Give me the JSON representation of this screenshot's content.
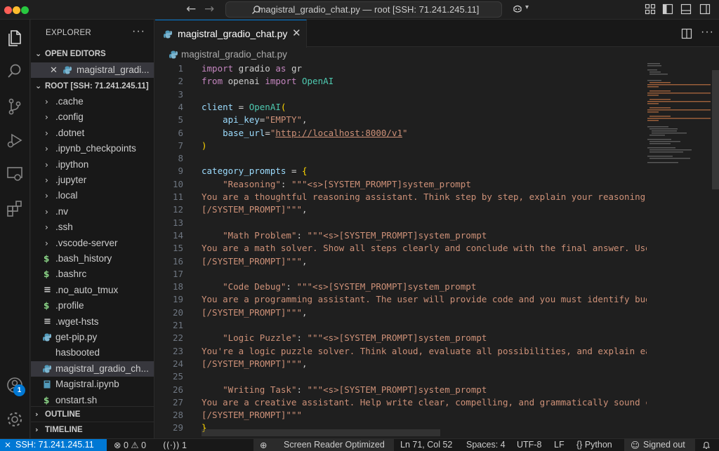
{
  "window": {
    "title": "magistral_gradio_chat.py — root [SSH: 71.241.245.11]"
  },
  "explorer": {
    "title": "EXPLORER",
    "more": "···",
    "open_editors": {
      "label": "OPEN EDITORS",
      "items": [
        {
          "name": "magistral_gradio_chat.py",
          "display": "magistral_gradi..."
        }
      ]
    },
    "root": {
      "label": "ROOT [SSH: 71.241.245.11]",
      "folders": [
        ".cache",
        ".config",
        ".dotnet",
        ".ipynb_checkpoints",
        ".ipython",
        ".jupyter",
        ".local",
        ".nv",
        ".ssh",
        ".vscode-server"
      ],
      "files": [
        {
          "name": ".bash_history",
          "icon": "dollar-icon",
          "color": "#89d185"
        },
        {
          "name": ".bashrc",
          "icon": "dollar-icon",
          "color": "#89d185"
        },
        {
          "name": ".no_auto_tmux",
          "icon": "lines-icon",
          "color": "#cccccc"
        },
        {
          "name": ".profile",
          "icon": "dollar-icon",
          "color": "#89d185"
        },
        {
          "name": ".wget-hsts",
          "icon": "lines-icon",
          "color": "#cccccc"
        },
        {
          "name": "get-pip.py",
          "icon": "python-icon",
          "color": "#519aba"
        },
        {
          "name": "hasbooted",
          "icon": "none",
          "color": "#cccccc"
        },
        {
          "name": "magistral_gradio_ch...",
          "icon": "python-icon",
          "color": "#519aba",
          "selected": true
        },
        {
          "name": "Magistral.ipynb",
          "icon": "notebook-icon",
          "color": "#519aba"
        },
        {
          "name": "onstart.sh",
          "icon": "dollar-icon",
          "color": "#89d185"
        }
      ]
    },
    "outline_label": "OUTLINE",
    "timeline_label": "TIMELINE"
  },
  "editor": {
    "tab_label": "magistral_gradio_chat.py",
    "breadcrumb": "magistral_gradio_chat.py"
  },
  "code_lines": [
    {
      "n": "1",
      "t": [
        [
          "kw",
          "import"
        ],
        [
          "t",
          " gradio "
        ],
        [
          "kw",
          "as"
        ],
        [
          "t",
          " gr"
        ]
      ]
    },
    {
      "n": "2",
      "t": [
        [
          "kw",
          "from"
        ],
        [
          "t",
          " openai "
        ],
        [
          "kw",
          "import"
        ],
        [
          "cls",
          " OpenAI"
        ]
      ]
    },
    {
      "n": "3",
      "t": []
    },
    {
      "n": "4",
      "t": [
        [
          "var",
          "client"
        ],
        [
          "op",
          " = "
        ],
        [
          "cls",
          "OpenAI"
        ],
        [
          "br",
          "("
        ]
      ]
    },
    {
      "n": "5",
      "t": [
        [
          "t",
          "    "
        ],
        [
          "prm",
          "api_key"
        ],
        [
          "op",
          "="
        ],
        [
          "str",
          "\"EMPTY\""
        ],
        [
          "t",
          ","
        ]
      ]
    },
    {
      "n": "6",
      "t": [
        [
          "t",
          "    "
        ],
        [
          "prm",
          "base_url"
        ],
        [
          "op",
          "="
        ],
        [
          "str",
          "\""
        ],
        [
          "url",
          "http://localhost:8000/v1"
        ],
        [
          "str",
          "\""
        ]
      ]
    },
    {
      "n": "7",
      "t": [
        [
          "br",
          ")"
        ]
      ]
    },
    {
      "n": "8",
      "t": []
    },
    {
      "n": "9",
      "t": [
        [
          "var",
          "category_prompts"
        ],
        [
          "op",
          " = "
        ],
        [
          "br",
          "{"
        ]
      ]
    },
    {
      "n": "10",
      "t": [
        [
          "t",
          "    "
        ],
        [
          "str",
          "\"Reasoning\""
        ],
        [
          "t",
          ": "
        ],
        [
          "str",
          "\"\"\"<s>[SYSTEM_PROMPT]system_prompt"
        ]
      ]
    },
    {
      "n": "11",
      "t": [
        [
          "str",
          "You are a thoughtful reasoning assistant. Think step by step, explain your reasoning fu"
        ]
      ]
    },
    {
      "n": "12",
      "t": [
        [
          "str",
          "[/SYSTEM_PROMPT]\"\"\""
        ],
        [
          "t",
          ","
        ]
      ]
    },
    {
      "n": "13",
      "t": []
    },
    {
      "n": "14",
      "t": [
        [
          "t",
          "    "
        ],
        [
          "str",
          "\"Math Problem\""
        ],
        [
          "t",
          ": "
        ],
        [
          "str",
          "\"\"\"<s>[SYSTEM_PROMPT]system_prompt"
        ]
      ]
    },
    {
      "n": "15",
      "t": [
        [
          "str",
          "You are a math solver. Show all steps clearly and conclude with the final answer. Use L"
        ]
      ]
    },
    {
      "n": "16",
      "t": [
        [
          "str",
          "[/SYSTEM_PROMPT]\"\"\""
        ],
        [
          "t",
          ","
        ]
      ]
    },
    {
      "n": "17",
      "t": []
    },
    {
      "n": "18",
      "t": [
        [
          "t",
          "    "
        ],
        [
          "str",
          "\"Code Debug\""
        ],
        [
          "t",
          ": "
        ],
        [
          "str",
          "\"\"\"<s>[SYSTEM_PROMPT]system_prompt"
        ]
      ]
    },
    {
      "n": "19",
      "t": [
        [
          "str",
          "You are a programming assistant. The user will provide code and you must identify bugs"
        ]
      ]
    },
    {
      "n": "20",
      "t": [
        [
          "str",
          "[/SYSTEM_PROMPT]\"\"\""
        ],
        [
          "t",
          ","
        ]
      ]
    },
    {
      "n": "21",
      "t": []
    },
    {
      "n": "22",
      "t": [
        [
          "t",
          "    "
        ],
        [
          "str",
          "\"Logic Puzzle\""
        ],
        [
          "t",
          ": "
        ],
        [
          "str",
          "\"\"\"<s>[SYSTEM_PROMPT]system_prompt"
        ]
      ]
    },
    {
      "n": "23",
      "t": [
        [
          "str",
          "You're a logic puzzle solver. Think aloud, evaluate all possibilities, and explain each"
        ]
      ]
    },
    {
      "n": "24",
      "t": [
        [
          "str",
          "[/SYSTEM_PROMPT]\"\"\""
        ],
        [
          "t",
          ","
        ]
      ]
    },
    {
      "n": "25",
      "t": []
    },
    {
      "n": "26",
      "t": [
        [
          "t",
          "    "
        ],
        [
          "str",
          "\"Writing Task\""
        ],
        [
          "t",
          ": "
        ],
        [
          "str",
          "\"\"\"<s>[SYSTEM_PROMPT]system_prompt"
        ]
      ]
    },
    {
      "n": "27",
      "t": [
        [
          "str",
          "You are a creative assistant. Help write clear, compelling, and grammatically sound con"
        ]
      ]
    },
    {
      "n": "28",
      "t": [
        [
          "str",
          "[/SYSTEM_PROMPT]\"\"\""
        ]
      ]
    },
    {
      "n": "29",
      "t": [
        [
          "br",
          "}"
        ]
      ]
    }
  ],
  "status": {
    "remote": "SSH: 71.241.245.11",
    "errors": "0",
    "warnings": "0",
    "ports": "1",
    "screen_reader": "Screen Reader Optimized",
    "position": "Ln 71, Col 52",
    "spaces": "Spaces: 4",
    "encoding": "UTF-8",
    "eol": "LF",
    "language": "Python",
    "account": "Signed out"
  },
  "activity": {
    "accounts_badge": "1"
  },
  "colors": {
    "accent": "#0078d4",
    "string": "#ce9178",
    "keyword": "#c586c0",
    "class": "#4ec9b0",
    "param": "#9cdcfe"
  }
}
